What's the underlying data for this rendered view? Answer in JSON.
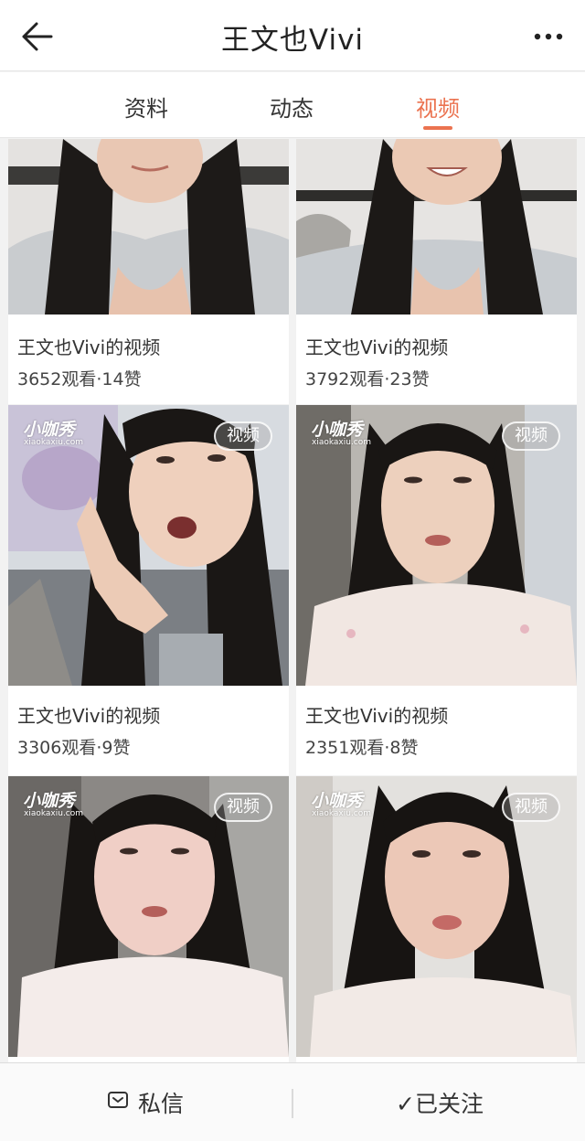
{
  "header": {
    "title": "王文也Vivi",
    "back_icon": "back-arrow-icon",
    "more_icon": "more-dots-icon"
  },
  "tabs": [
    {
      "label": "资料",
      "active": false
    },
    {
      "label": "动态",
      "active": false
    },
    {
      "label": "视频",
      "active": true
    }
  ],
  "accent_color": "#eb7350",
  "videos": [
    {
      "title": "王文也Vivi的视频",
      "stats": "3652观看·14赞",
      "badge": "",
      "watermark": ""
    },
    {
      "title": "王文也Vivi的视频",
      "stats": "3792观看·23赞",
      "badge": "",
      "watermark": ""
    },
    {
      "title": "王文也Vivi的视频",
      "stats": "3306观看·9赞",
      "badge": "视频",
      "watermark": "小咖秀",
      "watermark_sub": "xiaokaxiu.com"
    },
    {
      "title": "王文也Vivi的视频",
      "stats": "2351观看·8赞",
      "badge": "视频",
      "watermark": "小咖秀",
      "watermark_sub": "xiaokaxiu.com"
    },
    {
      "title": "",
      "stats": "",
      "badge": "视频",
      "watermark": "小咖秀",
      "watermark_sub": "xiaokaxiu.com"
    },
    {
      "title": "",
      "stats": "",
      "badge": "视频",
      "watermark": "小咖秀",
      "watermark_sub": "xiaokaxiu.com"
    }
  ],
  "bottom_bar": {
    "message_label": "私信",
    "message_icon": "message-icon",
    "follow_label": "✓已关注",
    "follow_icon": "check-icon"
  }
}
